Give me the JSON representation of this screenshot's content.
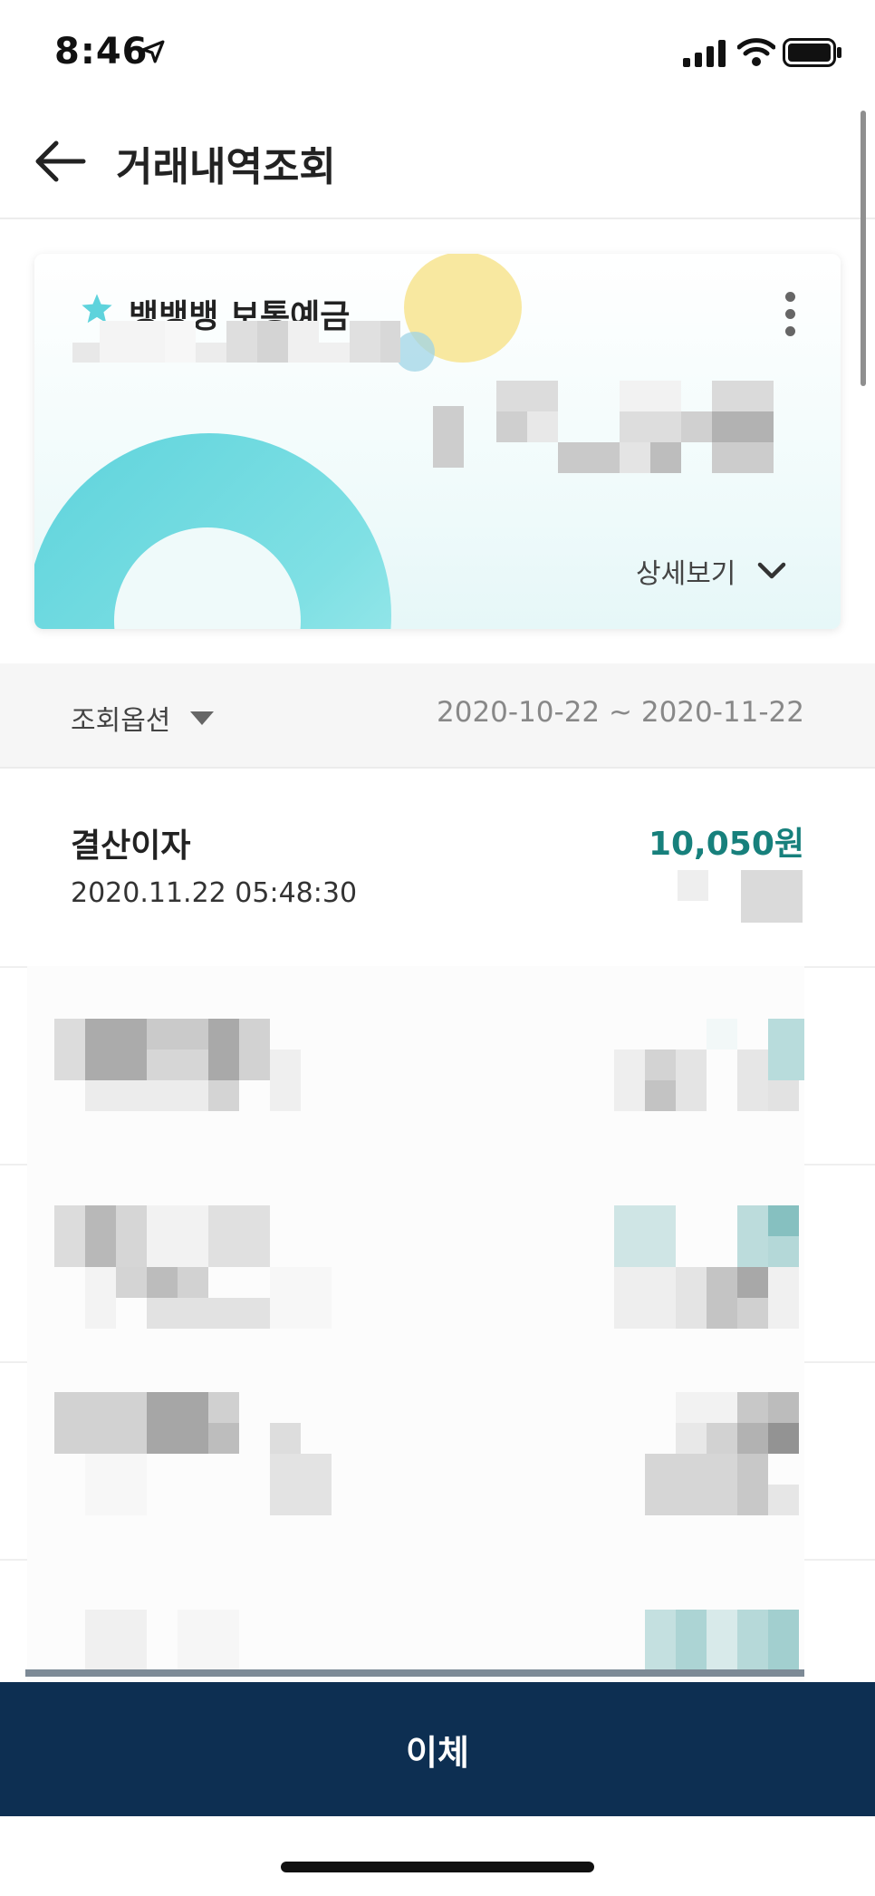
{
  "status_bar": {
    "time": "8:46"
  },
  "header": {
    "title": "거래내역조회"
  },
  "account_card": {
    "name": "뱅뱅뱅 보통예금",
    "details_label": "상세보기",
    "accent_color": "#5ed3dc"
  },
  "filter": {
    "option_label": "조회옵션",
    "date_range": "2020-10-22 ~ 2020-11-22"
  },
  "transactions": [
    {
      "title": "결산이자",
      "datetime": "2020.11.22 05:48:30",
      "amount": "10,050원"
    }
  ],
  "colors": {
    "amount_positive": "#17807c",
    "primary_button": "#0d2f52"
  },
  "actions": {
    "transfer_label": "이체"
  }
}
